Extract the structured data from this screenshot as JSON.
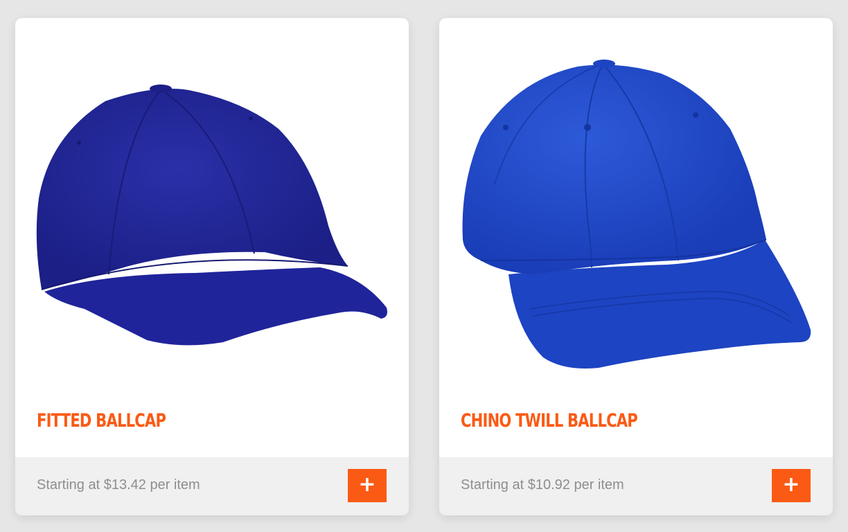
{
  "products": [
    {
      "title": "FITTED BALLCAP",
      "price_text": "Starting at $13.42 per item",
      "add_symbol": "+",
      "image_icon": "navy-ballcap-image",
      "cap_color": "#22279a"
    },
    {
      "title": "CHINO TWILL BALLCAP",
      "price_text": "Starting at $10.92 per item",
      "add_symbol": "+",
      "image_icon": "royal-blue-ballcap-image",
      "cap_color": "#1c45c7"
    }
  ],
  "colors": {
    "accent": "#fb5a14",
    "footer_bg": "#f0f0f0",
    "price_text": "#8e8e8e",
    "page_bg": "#e6e6e6"
  }
}
